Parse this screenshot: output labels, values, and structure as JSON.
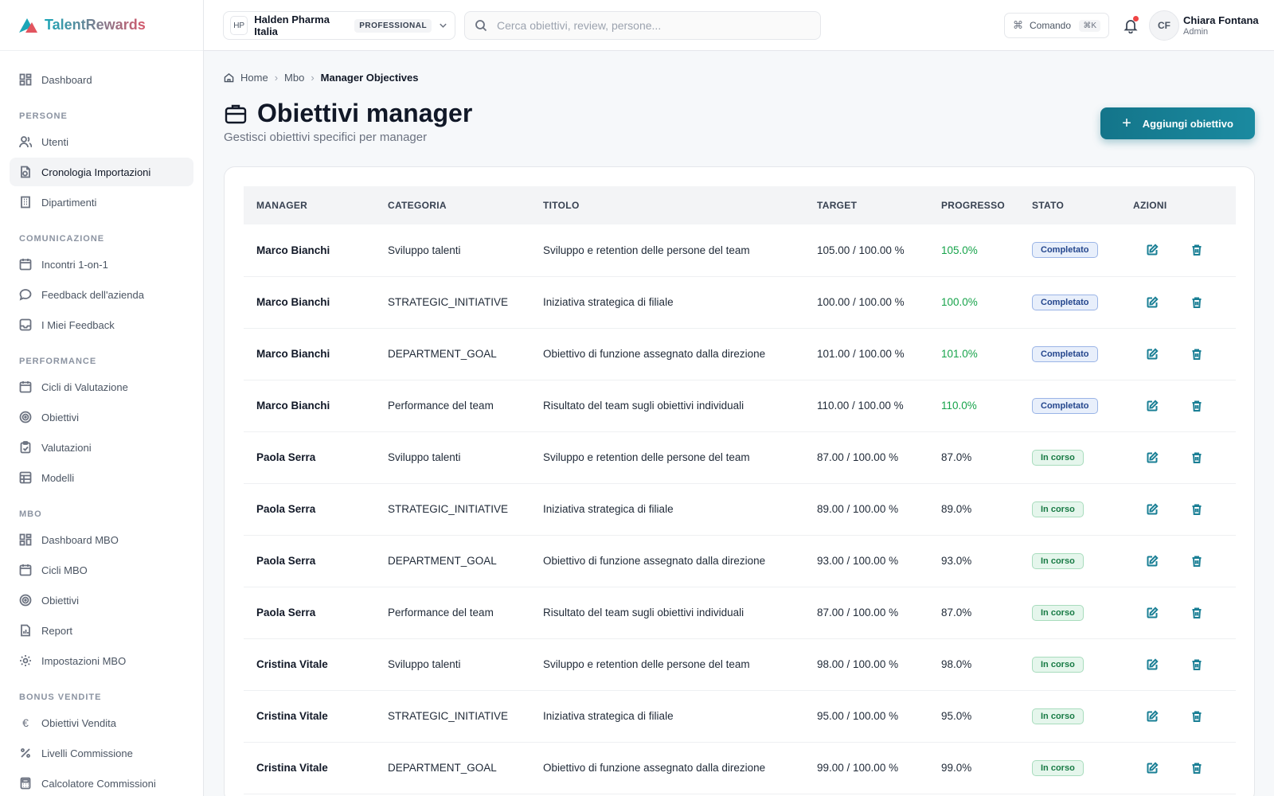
{
  "brand": {
    "name": "TalentRewards"
  },
  "sidebar": {
    "items": [
      {
        "label": "Dashboard"
      },
      {
        "section": "PERSONE"
      },
      {
        "label": "Utenti"
      },
      {
        "label": "Cronologia Importazioni",
        "active": true
      },
      {
        "label": "Dipartimenti"
      },
      {
        "section": "COMUNICAZIONE"
      },
      {
        "label": "Incontri 1-on-1"
      },
      {
        "label": "Feedback dell'azienda"
      },
      {
        "label": "I Miei Feedback"
      },
      {
        "section": "PERFORMANCE"
      },
      {
        "label": "Cicli di Valutazione"
      },
      {
        "label": "Obiettivi"
      },
      {
        "label": "Valutazioni"
      },
      {
        "label": "Modelli"
      },
      {
        "section": "MBO"
      },
      {
        "label": "Dashboard MBO"
      },
      {
        "label": "Cicli MBO"
      },
      {
        "label": "Obiettivi"
      },
      {
        "label": "Report"
      },
      {
        "label": "Impostazioni MBO"
      },
      {
        "section": "BONUS VENDITE"
      },
      {
        "label": "Obiettivi Vendita"
      },
      {
        "label": "Livelli Commissione"
      },
      {
        "label": "Calcolatore Commissioni"
      }
    ]
  },
  "header": {
    "org_badge": "HP",
    "org_name": "Halden Pharma Italia",
    "org_plan": "PROFESSIONAL",
    "search_placeholder": "Cerca obiettivi, review, persone...",
    "command_label": "Comando",
    "command_kbd": "⌘K",
    "user_initials": "CF",
    "user_name": "Chiara Fontana",
    "user_role": "Admin"
  },
  "breadcrumb": {
    "home": "Home",
    "mbo": "Mbo",
    "current": "Manager Objectives"
  },
  "page": {
    "title": "Obiettivi manager",
    "subtitle": "Gestisci obiettivi specifici per manager",
    "add_button": "Aggiungi obiettivo"
  },
  "table": {
    "headers": {
      "manager": "MANAGER",
      "categoria": "CATEGORIA",
      "titolo": "TITOLO",
      "target": "TARGET",
      "progresso": "PROGRESSO",
      "stato": "STATO",
      "azioni": "AZIONI"
    },
    "rows": [
      {
        "manager": "Marco Bianchi",
        "categoria": "Sviluppo talenti",
        "titolo": "Sviluppo e retention delle persone del team",
        "target": "105.00 / 100.00 %",
        "progresso": "105.0%",
        "stato": "Completato",
        "done": true
      },
      {
        "manager": "Marco Bianchi",
        "categoria": "STRATEGIC_INITIATIVE",
        "titolo": "Iniziativa strategica di filiale",
        "target": "100.00 / 100.00 %",
        "progresso": "100.0%",
        "stato": "Completato",
        "done": true
      },
      {
        "manager": "Marco Bianchi",
        "categoria": "DEPARTMENT_GOAL",
        "titolo": "Obiettivo di funzione assegnato dalla direzione",
        "target": "101.00 / 100.00 %",
        "progresso": "101.0%",
        "stato": "Completato",
        "done": true
      },
      {
        "manager": "Marco Bianchi",
        "categoria": "Performance del team",
        "titolo": "Risultato del team sugli obiettivi individuali",
        "target": "110.00 / 100.00 %",
        "progresso": "110.0%",
        "stato": "Completato",
        "done": true
      },
      {
        "manager": "Paola Serra",
        "categoria": "Sviluppo talenti",
        "titolo": "Sviluppo e retention delle persone del team",
        "target": "87.00 / 100.00 %",
        "progresso": "87.0%",
        "stato": "In corso",
        "done": false
      },
      {
        "manager": "Paola Serra",
        "categoria": "STRATEGIC_INITIATIVE",
        "titolo": "Iniziativa strategica di filiale",
        "target": "89.00 / 100.00 %",
        "progresso": "89.0%",
        "stato": "In corso",
        "done": false
      },
      {
        "manager": "Paola Serra",
        "categoria": "DEPARTMENT_GOAL",
        "titolo": "Obiettivo di funzione assegnato dalla direzione",
        "target": "93.00 / 100.00 %",
        "progresso": "93.0%",
        "stato": "In corso",
        "done": false
      },
      {
        "manager": "Paola Serra",
        "categoria": "Performance del team",
        "titolo": "Risultato del team sugli obiettivi individuali",
        "target": "87.00 / 100.00 %",
        "progresso": "87.0%",
        "stato": "In corso",
        "done": false
      },
      {
        "manager": "Cristina Vitale",
        "categoria": "Sviluppo talenti",
        "titolo": "Sviluppo e retention delle persone del team",
        "target": "98.00 / 100.00 %",
        "progresso": "98.0%",
        "stato": "In corso",
        "done": false
      },
      {
        "manager": "Cristina Vitale",
        "categoria": "STRATEGIC_INITIATIVE",
        "titolo": "Iniziativa strategica di filiale",
        "target": "95.00 / 100.00 %",
        "progresso": "95.0%",
        "stato": "In corso",
        "done": false
      },
      {
        "manager": "Cristina Vitale",
        "categoria": "DEPARTMENT_GOAL",
        "titolo": "Obiettivo di funzione assegnato dalla direzione",
        "target": "99.00 / 100.00 %",
        "progresso": "99.0%",
        "stato": "In corso",
        "done": false
      }
    ]
  },
  "colors": {
    "accent": "#14758a",
    "success": "#16a34a"
  }
}
